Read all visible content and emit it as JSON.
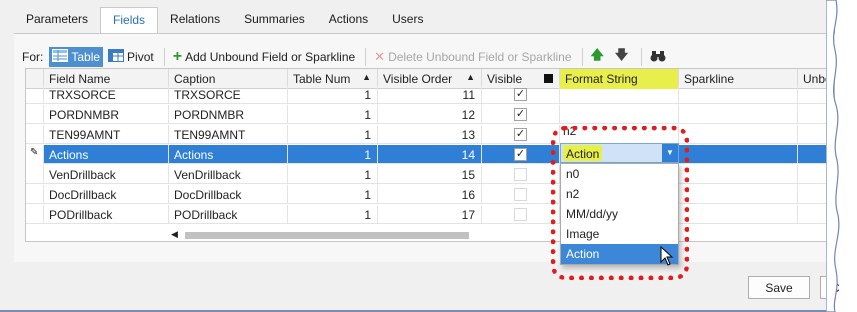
{
  "tabs": [
    {
      "label": "Parameters"
    },
    {
      "label": "Fields"
    },
    {
      "label": "Relations"
    },
    {
      "label": "Summaries"
    },
    {
      "label": "Actions"
    },
    {
      "label": "Users"
    }
  ],
  "toolbar": {
    "for_label": "For:",
    "table_label": "Table",
    "pivot_label": "Pivot",
    "add_label": "Add Unbound Field or Sparkline",
    "delete_label": "Delete Unbound Field or Sparkline"
  },
  "grid": {
    "headers": [
      "Field Name",
      "Caption",
      "Table Num",
      "Visible Order",
      "Visible",
      "Format String",
      "Sparkline",
      "Unbou"
    ],
    "rows": [
      {
        "field": "TRXSORCE",
        "caption": "TRXSORCE",
        "table_num": "1",
        "order": "11",
        "visible": true
      },
      {
        "field": "PORDNMBR",
        "caption": "PORDNMBR",
        "table_num": "1",
        "order": "12",
        "visible": true
      },
      {
        "field": "TEN99AMNT",
        "caption": "TEN99AMNT",
        "table_num": "1",
        "order": "13",
        "visible": true
      },
      {
        "field": "Actions",
        "caption": "Actions",
        "table_num": "1",
        "order": "14",
        "visible": true
      },
      {
        "field": "VenDrillback",
        "caption": "VenDrillback",
        "table_num": "1",
        "order": "15",
        "visible": false
      },
      {
        "field": "DocDrillback",
        "caption": "DocDrillback",
        "table_num": "1",
        "order": "16",
        "visible": false
      },
      {
        "field": "PODrillback",
        "caption": "PODrillback",
        "table_num": "1",
        "order": "17",
        "visible": false
      }
    ],
    "selected_row": 3
  },
  "format_combo": {
    "value": "Action",
    "partial_above": "n2",
    "options": [
      "n0",
      "n2",
      "MM/dd/yy",
      "Image",
      "Action"
    ],
    "selected_option": "Action"
  },
  "buttons": {
    "save_label": "Save",
    "cancel_partial": "C"
  },
  "colors": {
    "accent": "#2f7fd6",
    "highlight": "#e8ef4a",
    "callout": "#e21b1b"
  }
}
